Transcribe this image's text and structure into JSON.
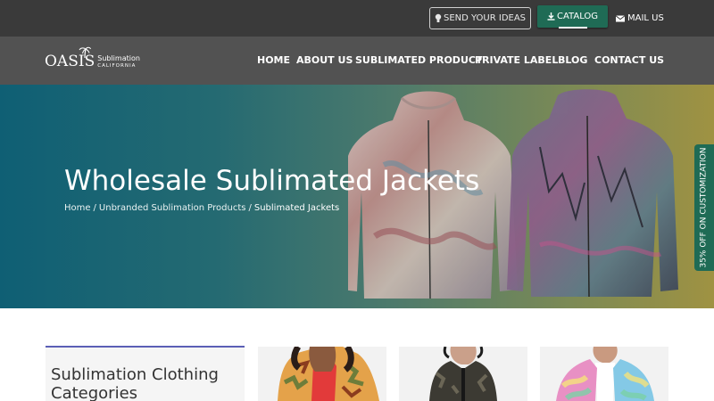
{
  "topbar": {
    "ideas_label": "SEND YOUR IDEAS",
    "catalog_label": "CATALOG",
    "mail_label": "MAIL US",
    "icons": [
      "bulb-icon",
      "download-icon",
      "envelope-icon"
    ]
  },
  "brand": {
    "name": "OASIS",
    "line1": "Sublimation",
    "line2": "CALIFORNIA"
  },
  "nav": {
    "items": [
      {
        "label": "HOME"
      },
      {
        "label": "ABOUT US"
      },
      {
        "label": "SUBLIMATED PRODUCT"
      },
      {
        "label": "PRIVATE LABEL"
      },
      {
        "label": "BLOG"
      },
      {
        "label": "CONTACT US"
      }
    ]
  },
  "hero": {
    "title": "Wholesale Sublimated Jackets",
    "breadcrumb": [
      {
        "label": "Home"
      },
      {
        "label": "Unbranded Sublimation Products"
      },
      {
        "label": "Sublimated Jackets"
      }
    ],
    "separator": "/"
  },
  "side_tab": {
    "label": "35% OFF ON CUSTOMIZATION"
  },
  "sidebar": {
    "title": "Sublimation Clothing Categories"
  },
  "products": [
    {
      "image": "camo-jacket-woman"
    },
    {
      "image": "dark-camo-jacket-man"
    },
    {
      "image": "tie-dye-jacket-man"
    }
  ],
  "colors": {
    "topbar": "#3a3a3a",
    "navbar": "#525252",
    "accent_green": "#1f6b55",
    "category_border": "#5b5fb6"
  }
}
